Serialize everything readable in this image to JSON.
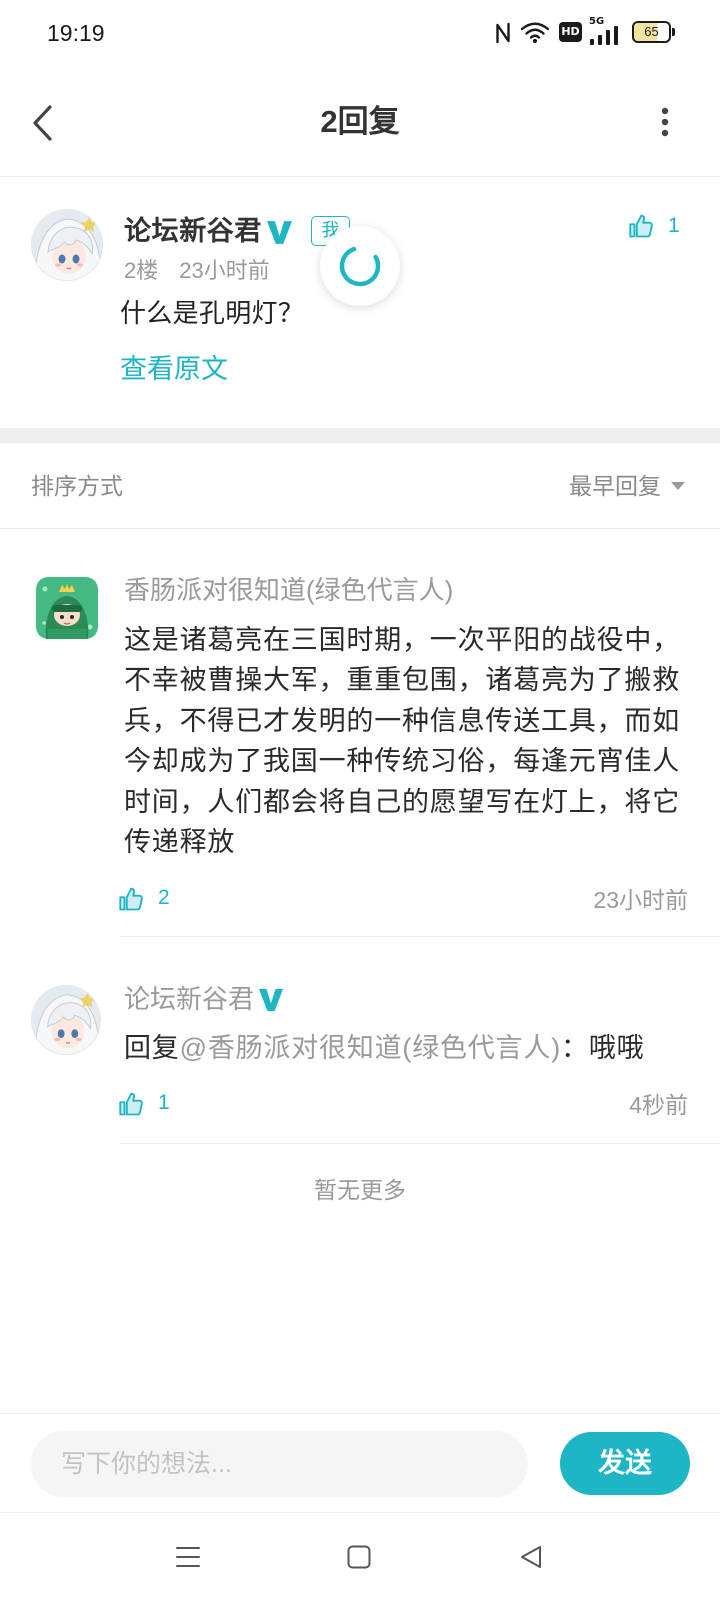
{
  "status_bar": {
    "time": "19:19",
    "hd_label": "HD",
    "network_label": "5G",
    "battery_level": "65",
    "icons": [
      "nfc-icon",
      "wifi-icon",
      "hd-icon",
      "signal-5g-icon",
      "battery-icon"
    ]
  },
  "header": {
    "title": "2回复",
    "left_icon": "chevron-left-icon",
    "right_icon": "more-vertical-icon"
  },
  "post": {
    "author": "论坛新谷君",
    "verified": true,
    "self_badge": "我",
    "floor": "2楼",
    "time": "23小时前",
    "content": "什么是孔明灯？",
    "view_original": "查看原文",
    "like_count": "1",
    "loading": true
  },
  "sort": {
    "label": "排序方式",
    "selected": "最早回复",
    "icon": "caret-down-icon"
  },
  "replies": [
    {
      "author": "香肠派对很知道(绿色代言人)",
      "verified": false,
      "content": "这是诸葛亮在三国时期，一次平阳的战役中，不幸被曹操大军，重重包围，诸葛亮为了搬救兵，不得已才发明的一种信息传送工具，而如今却成为了我国一种传统习俗，每逢元宵佳人时间，人们都会将自己的愿望写在灯上，将它传递释放",
      "like_count": "2",
      "time": "23小时前"
    },
    {
      "author": "论坛新谷君",
      "verified": true,
      "reply_prefix": "回复",
      "mention": "@香肠派对很知道(绿色代言人)",
      "separator": "：",
      "content": "哦哦",
      "like_count": "1",
      "time": "4秒前"
    }
  ],
  "list_end": "暂无更多",
  "composer": {
    "placeholder": "写下你的想法...",
    "send_label": "发送"
  },
  "nav_bar": {
    "icons": [
      "menu-icon",
      "home-icon",
      "back-icon"
    ]
  },
  "colors": {
    "accent": "#1eb5c5",
    "text_primary": "#333333",
    "text_secondary": "#999999",
    "section_gap": "#eeeeee",
    "input_background": "#f5f5f5"
  }
}
